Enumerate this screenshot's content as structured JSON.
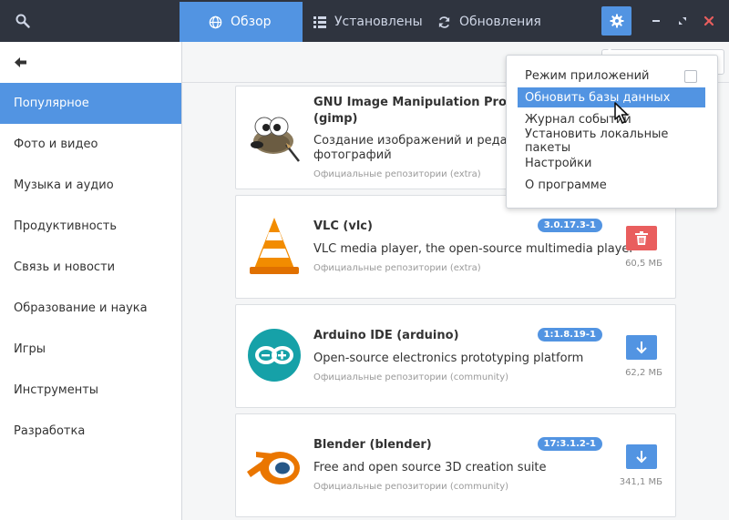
{
  "header": {
    "tabs": [
      {
        "label": "Обзор",
        "icon": "globe-icon",
        "active": true
      },
      {
        "label": "Установлены",
        "icon": "list-icon",
        "active": false
      },
      {
        "label": "Обновления",
        "icon": "refresh-icon",
        "active": false
      }
    ],
    "accent": "#5294e2",
    "close_color": "#e95e5e"
  },
  "sidebar": {
    "categories": [
      {
        "label": "Популярное",
        "active": true
      },
      {
        "label": "Фото и видео"
      },
      {
        "label": "Музыка и аудио"
      },
      {
        "label": "Продуктивность"
      },
      {
        "label": "Связь и новости"
      },
      {
        "label": "Образование и наука"
      },
      {
        "label": "Игры"
      },
      {
        "label": "Инструменты"
      },
      {
        "label": "Разработка"
      }
    ]
  },
  "packages": [
    {
      "name": "GNU Image Manipulation Program",
      "id": "(gimp)",
      "description": "Создание изображений и редактирование фотографий",
      "desc_line1": "Создание изображений и редактир",
      "desc_line2": "фотографий",
      "repo": "Официальные репозитории (extra)",
      "icon": "gimp-icon"
    },
    {
      "name": "VLC (vlc)",
      "description": "VLC media player, the open-source multimedia player",
      "repo": "Официальные репозитории (extra)",
      "version": "3.0.17.3-1",
      "size": "60,5 МБ",
      "action": "remove",
      "icon": "vlc-icon"
    },
    {
      "name": "Arduino IDE (arduino)",
      "description": "Open-source electronics prototyping platform",
      "repo": "Официальные репозитории (community)",
      "version": "1:1.8.19-1",
      "size": "62,2 МБ",
      "action": "install",
      "icon": "arduino-icon"
    },
    {
      "name": "Blender (blender)",
      "description": "Free and open source 3D creation suite",
      "repo": "Официальные репозитории (community)",
      "version": "17:3.1.2-1",
      "size": "341,1 МБ",
      "action": "install",
      "icon": "blender-icon"
    }
  ],
  "menu": {
    "items": [
      {
        "label": "Режим приложений",
        "checkbox": true,
        "checked": false
      },
      {
        "label": "Обновить базы данных",
        "highlighted": true
      },
      {
        "label": "Журнал событий"
      },
      {
        "label": "Установить локальные пакеты"
      },
      {
        "label": "Настройки"
      },
      {
        "label": "О программе"
      }
    ]
  }
}
